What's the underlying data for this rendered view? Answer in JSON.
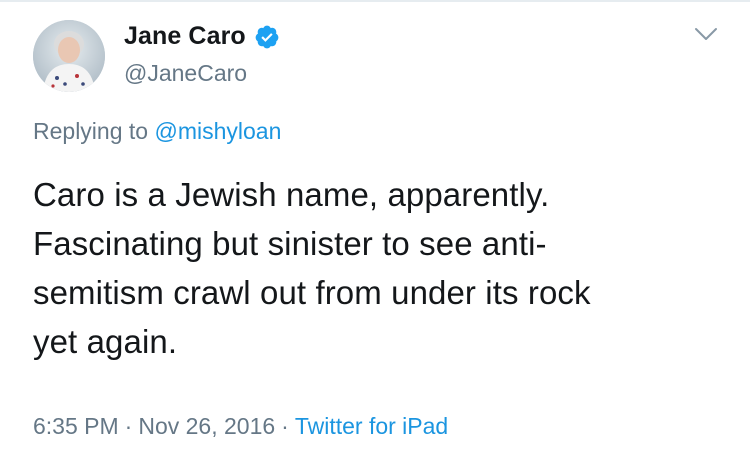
{
  "author": {
    "display_name": "Jane Caro",
    "handle": "@JaneCaro",
    "verified": true
  },
  "reply": {
    "prefix": "Replying to",
    "target": "@mishyloan"
  },
  "tweet": {
    "text_lines": [
      "Caro is a Jewish name, apparently.",
      "Fascinating but sinister to see anti-",
      "semitism crawl out from under its rock",
      "yet again."
    ]
  },
  "meta": {
    "time": "6:35 PM",
    "separator": "·",
    "date": "Nov 26, 2016",
    "source": "Twitter for iPad"
  },
  "icons": {
    "verified": "verified-badge-icon",
    "caret": "chevron-down-icon"
  },
  "colors": {
    "text": "#14171a",
    "secondary": "#657786",
    "link": "#1b95e0",
    "verified": "#1da1f2"
  }
}
